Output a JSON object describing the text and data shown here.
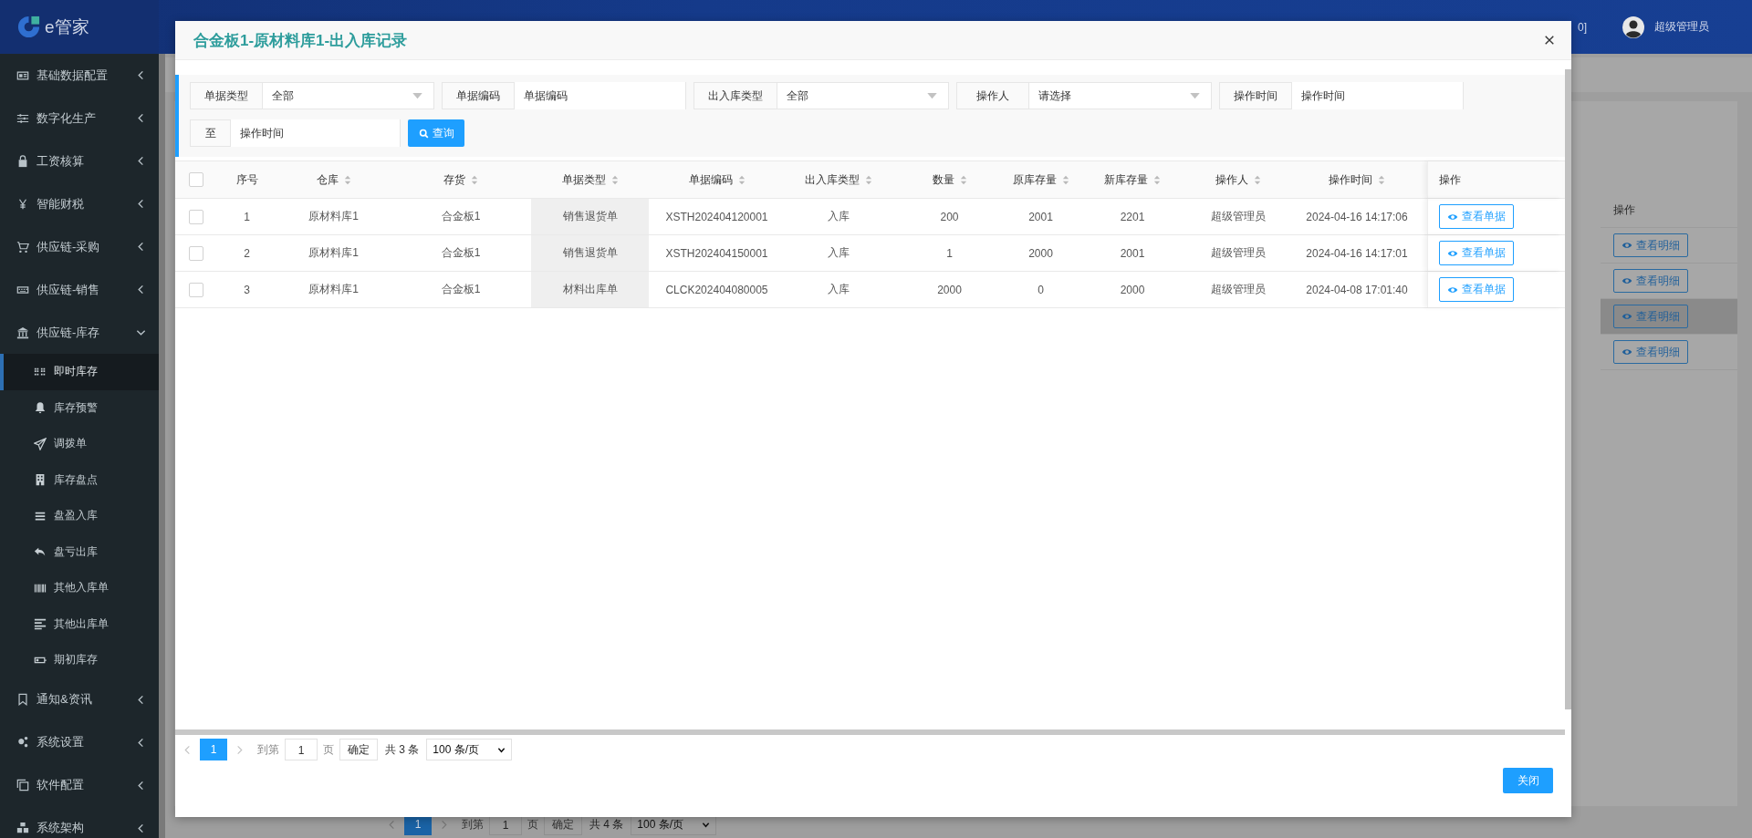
{
  "header": {
    "logo": "e管家",
    "fragment": "0]",
    "user": "超级管理员"
  },
  "sidebar": {
    "items": [
      {
        "label": "基础数据配置",
        "expanded": false
      },
      {
        "label": "数字化生产",
        "expanded": false
      },
      {
        "label": "工资核算",
        "expanded": false
      },
      {
        "label": "智能财税",
        "expanded": false
      },
      {
        "label": "供应链-采购",
        "expanded": false
      },
      {
        "label": "供应链-销售",
        "expanded": false
      },
      {
        "label": "供应链-库存",
        "expanded": true,
        "children": [
          {
            "label": "即时库存",
            "selected": true
          },
          {
            "label": "库存预警",
            "selected": false
          },
          {
            "label": "调拨单",
            "selected": false
          },
          {
            "label": "库存盘点",
            "selected": false
          },
          {
            "label": "盘盈入库",
            "selected": false
          },
          {
            "label": "盘亏出库",
            "selected": false
          },
          {
            "label": "其他入库单",
            "selected": false
          },
          {
            "label": "其他出库单",
            "selected": false
          },
          {
            "label": "期初库存",
            "selected": false
          }
        ]
      },
      {
        "label": "通知&资讯",
        "expanded": false
      },
      {
        "label": "系统设置",
        "expanded": false
      },
      {
        "label": "软件配置",
        "expanded": false
      },
      {
        "label": "系统架构",
        "expanded": false
      }
    ]
  },
  "background": {
    "table": {
      "column": "操作",
      "rows": [
        {
          "action": "查看明细",
          "selected": false
        },
        {
          "action": "查看明细",
          "selected": false
        },
        {
          "action": "查看明细",
          "selected": true
        },
        {
          "action": "查看明细",
          "selected": false
        }
      ]
    },
    "pagination": {
      "current": "1",
      "goto_label": "到第",
      "goto_value": "1",
      "page_unit": "页",
      "confirm": "确定",
      "total": "共 4 条",
      "page_size": "100 条/页"
    }
  },
  "dialog": {
    "title": "合金板1-原材料库1-出入库记录",
    "filters": [
      {
        "kind": "select",
        "label": "单据类型",
        "value": "全部"
      },
      {
        "kind": "input",
        "label": "单据编码",
        "placeholder": "单据编码"
      },
      {
        "kind": "select",
        "label": "出入库类型",
        "value": "全部"
      },
      {
        "kind": "select",
        "label": "操作人",
        "placeholder": "请选择"
      },
      {
        "kind": "input",
        "label": "操作时间",
        "placeholder": "操作时间"
      },
      {
        "kind": "input",
        "label": "至",
        "placeholder": "操作时间"
      }
    ],
    "query_button": "查询",
    "table": {
      "columns": [
        {
          "label": "序号",
          "sortable": false,
          "shaded": false
        },
        {
          "label": "仓库",
          "sortable": true,
          "shaded": false
        },
        {
          "label": "存货",
          "sortable": true,
          "shaded": false
        },
        {
          "label": "单据类型",
          "sortable": true,
          "shaded": true
        },
        {
          "label": "单据编码",
          "sortable": true,
          "shaded": false
        },
        {
          "label": "出入库类型",
          "sortable": true,
          "shaded": false
        },
        {
          "label": "数量",
          "sortable": true,
          "shaded": false
        },
        {
          "label": "原库存量",
          "sortable": true,
          "shaded": false
        },
        {
          "label": "新库存量",
          "sortable": true,
          "shaded": false
        },
        {
          "label": "操作人",
          "sortable": true,
          "shaded": false
        },
        {
          "label": "操作时间",
          "sortable": true,
          "shaded": false
        },
        {
          "label": "操作",
          "sortable": false,
          "shaded": false
        }
      ],
      "all_checked": false,
      "rows": [
        {
          "checked": false,
          "cells": [
            "1",
            "原材料库1",
            "合金板1",
            "销售退货单",
            "XSTH202404120001",
            "入库",
            "200",
            "2001",
            "2201",
            "超级管理员",
            "2024-04-16 14:17:06"
          ],
          "action": "查看单据"
        },
        {
          "checked": false,
          "cells": [
            "2",
            "原材料库1",
            "合金板1",
            "销售退货单",
            "XSTH202404150001",
            "入库",
            "1",
            "2000",
            "2001",
            "超级管理员",
            "2024-04-16 14:17:01"
          ],
          "action": "查看单据"
        },
        {
          "checked": false,
          "cells": [
            "3",
            "原材料库1",
            "合金板1",
            "材料出库单",
            "CLCK202404080005",
            "入库",
            "2000",
            "0",
            "2000",
            "超级管理员",
            "2024-04-08 17:01:40"
          ],
          "action": "查看单据"
        }
      ]
    },
    "pagination": {
      "current": "1",
      "goto_label": "到第",
      "goto_value": "1",
      "page_unit": "页",
      "confirm": "确定",
      "total": "共 3 条",
      "page_size": "100 条/页"
    },
    "close_button": "关闭"
  }
}
